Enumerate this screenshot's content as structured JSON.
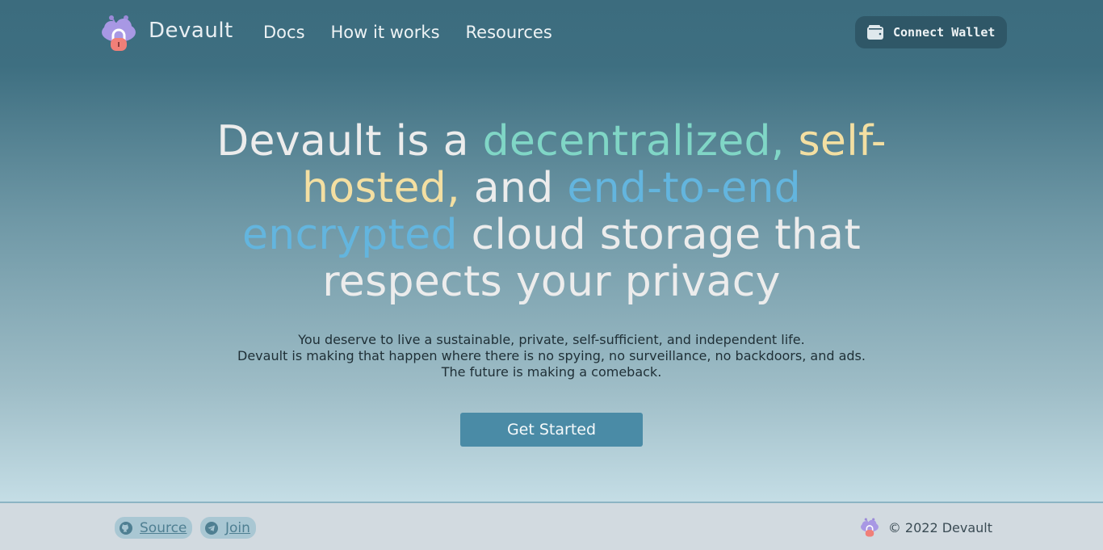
{
  "header": {
    "brand": "Devault",
    "nav": [
      "Docs",
      "How it works",
      "Resources"
    ],
    "wallet_label": "Connect Wallet"
  },
  "hero": {
    "p1": "Devault is a ",
    "p2": "decentralized,",
    "p3": " ",
    "p4": "self-hosted,",
    "p5": " and ",
    "p6": "end-to-end encrypted",
    "p7": " cloud storage that respects your privacy"
  },
  "subtext": [
    "You deserve to live a sustainable, private, self-sufficient, and independent life.",
    "Devault is making that happen where there is no spying, no surveillance, no backdoors, and ads.",
    "The future is making a comeback."
  ],
  "cta_label": "Get Started",
  "footer": {
    "source_label": "Source",
    "join_label": "Join",
    "copyright": "© 2022  Devault"
  },
  "colors": {
    "accent_green": "#80d6c6",
    "accent_yellow": "#f3dfa2",
    "accent_blue": "#63b5de",
    "button": "#4a8ba6",
    "wallet_button": "#2f5767"
  },
  "icons": {
    "logo": "purple-cloud-lock-logo",
    "wallet": "wallet-icon",
    "source": "github-icon",
    "join": "telegram-icon"
  }
}
